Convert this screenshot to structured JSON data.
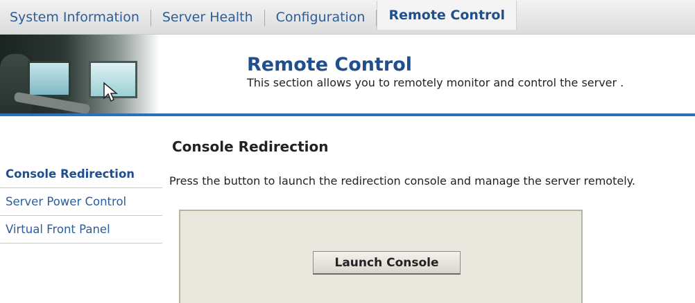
{
  "tabs": [
    {
      "label": "System Information"
    },
    {
      "label": "Server Health"
    },
    {
      "label": "Configuration"
    },
    {
      "label": "Remote Control",
      "active": true
    }
  ],
  "banner": {
    "title": "Remote Control",
    "subtitle": "This section allows you to remotely monitor and control the server ."
  },
  "sidebar": {
    "items": [
      {
        "label": "Console Redirection",
        "active": true
      },
      {
        "label": "Server Power Control"
      },
      {
        "label": "Virtual Front Panel"
      }
    ]
  },
  "main": {
    "section_title": "Console Redirection",
    "description": "Press the button to launch the redirection console and manage the server remotely.",
    "launch_button_label": "Launch Console"
  },
  "colors": {
    "link_blue": "#2a5d9a",
    "title_blue": "#1f4f8c",
    "banner_line": "#2f6fb3",
    "panel_bg": "#e9e8df"
  },
  "icons": {
    "banner_image": "operator-at-monitors-photo",
    "cursor": "mouse-pointer-icon"
  }
}
